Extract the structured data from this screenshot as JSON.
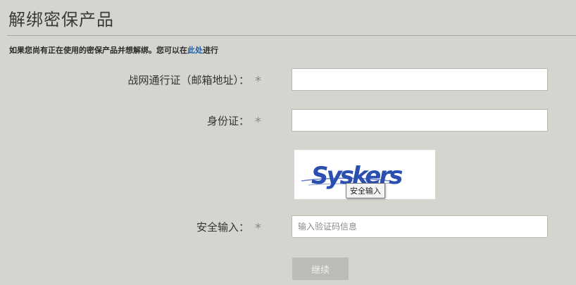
{
  "page": {
    "title": "解绑密保产品"
  },
  "notice": {
    "before": "如果您尚有正在使用的密保产品并想解绑。您可以在",
    "link": "此处",
    "after": "进行"
  },
  "form": {
    "email": {
      "label": "战网通行证（邮箱地址）：",
      "required_mark": "*",
      "value": ""
    },
    "id_card": {
      "label": "身份证：",
      "required_mark": "*",
      "value": ""
    },
    "captcha": {
      "text": "Syskers",
      "tooltip": "安全输入"
    },
    "security_input": {
      "label": "安全输入：",
      "required_mark": "*",
      "placeholder": "输入验证码信息"
    },
    "submit_label": "继续"
  },
  "colors": {
    "background": "#d6d4cf",
    "link": "#1b5ea8",
    "captcha_text": "#2a4fb0"
  }
}
